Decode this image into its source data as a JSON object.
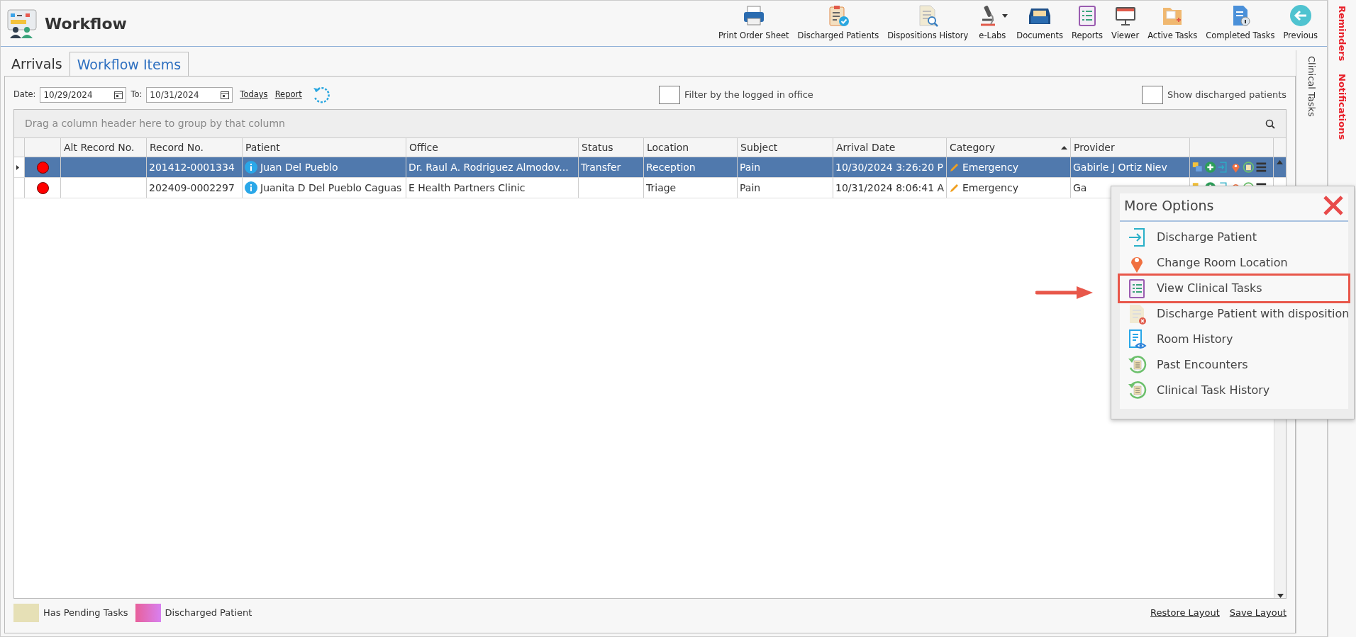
{
  "window": {
    "title": "Workflow"
  },
  "toolbar": [
    {
      "label": "Print Order Sheet",
      "kind": "printer"
    },
    {
      "label": "Discharged Patients",
      "kind": "clipboard-check"
    },
    {
      "label": "Dispositions History",
      "kind": "doc-search"
    },
    {
      "label": "e-Labs",
      "kind": "microscope",
      "dropdown": true
    },
    {
      "label": "Documents",
      "kind": "tray"
    },
    {
      "label": "Reports",
      "kind": "clipboard-list"
    },
    {
      "label": "Viewer",
      "kind": "monitor"
    },
    {
      "label": "Active Tasks",
      "kind": "folder"
    },
    {
      "label": "Completed Tasks",
      "kind": "doc-info"
    },
    {
      "label": "Previous",
      "kind": "back"
    }
  ],
  "side_tabs": [
    "Reminders",
    "Notifications"
  ],
  "panel_side_tab": "Clinical Tasks",
  "tabs": [
    {
      "label": "Arrivals",
      "selected": false
    },
    {
      "label": "Workflow Items",
      "selected": true
    }
  ],
  "filters": {
    "date_label": "Date:",
    "date_from": "10/29/2024",
    "to_label": "To:",
    "date_to": "10/31/2024",
    "links": [
      "Todays",
      "Report"
    ],
    "checkboxes": [
      {
        "label": "Filter by the logged in office",
        "checked": false
      },
      {
        "label": "Show discharged patients",
        "checked": false
      }
    ]
  },
  "grid": {
    "group_hint": "Drag a column header here to group by that column",
    "columns": [
      {
        "label": "Alt Record No."
      },
      {
        "label": "Record No."
      },
      {
        "label": "Patient"
      },
      {
        "label": "Office"
      },
      {
        "label": "Status"
      },
      {
        "label": "Location"
      },
      {
        "label": "Subject"
      },
      {
        "label": "Arrival Date"
      },
      {
        "label": "Category",
        "sorted": true
      },
      {
        "label": "Provider"
      }
    ],
    "rows": [
      {
        "selected": true,
        "color": "#ff0000",
        "cells": [
          "",
          "201412-0001334",
          "Juan Del Pueblo",
          "Dr. Raul A. Rodriguez Almodov...",
          "Transfer",
          "Reception",
          "Pain",
          "10/30/2024 3:26:20 P",
          "Emergency",
          "Gabirle J Ortiz Niev"
        ]
      },
      {
        "selected": false,
        "color": "#ff0000",
        "cells": [
          "",
          "202409-0002297",
          "Juanita D Del Pueblo Caguas",
          "E Health Partners Clinic",
          "",
          "Triage",
          "Pain",
          "10/31/2024 8:06:41 A",
          "Emergency",
          "Ga"
        ]
      }
    ]
  },
  "legend": [
    {
      "label": "Has Pending Tasks",
      "color": "#e6e0b6"
    },
    {
      "label": "Discharged Patient",
      "color": "#e8609a"
    }
  ],
  "footer_links": [
    "Restore Layout",
    "Save Layout"
  ],
  "popup": {
    "title": "More Options",
    "items": [
      {
        "label": "Discharge Patient",
        "kind": "enter",
        "highlighted": false
      },
      {
        "label": "Change Room Location",
        "kind": "pin",
        "highlighted": false
      },
      {
        "label": "View Clinical Tasks",
        "kind": "clipboard",
        "highlighted": true
      },
      {
        "label": "Discharge Patient with disposition",
        "kind": "doc-x",
        "highlighted": false
      },
      {
        "label": "Room History",
        "kind": "doc-eye",
        "highlighted": false
      },
      {
        "label": "Past Encounters",
        "kind": "history",
        "highlighted": false
      },
      {
        "label": "Clinical Task History",
        "kind": "history",
        "highlighted": false
      }
    ]
  }
}
